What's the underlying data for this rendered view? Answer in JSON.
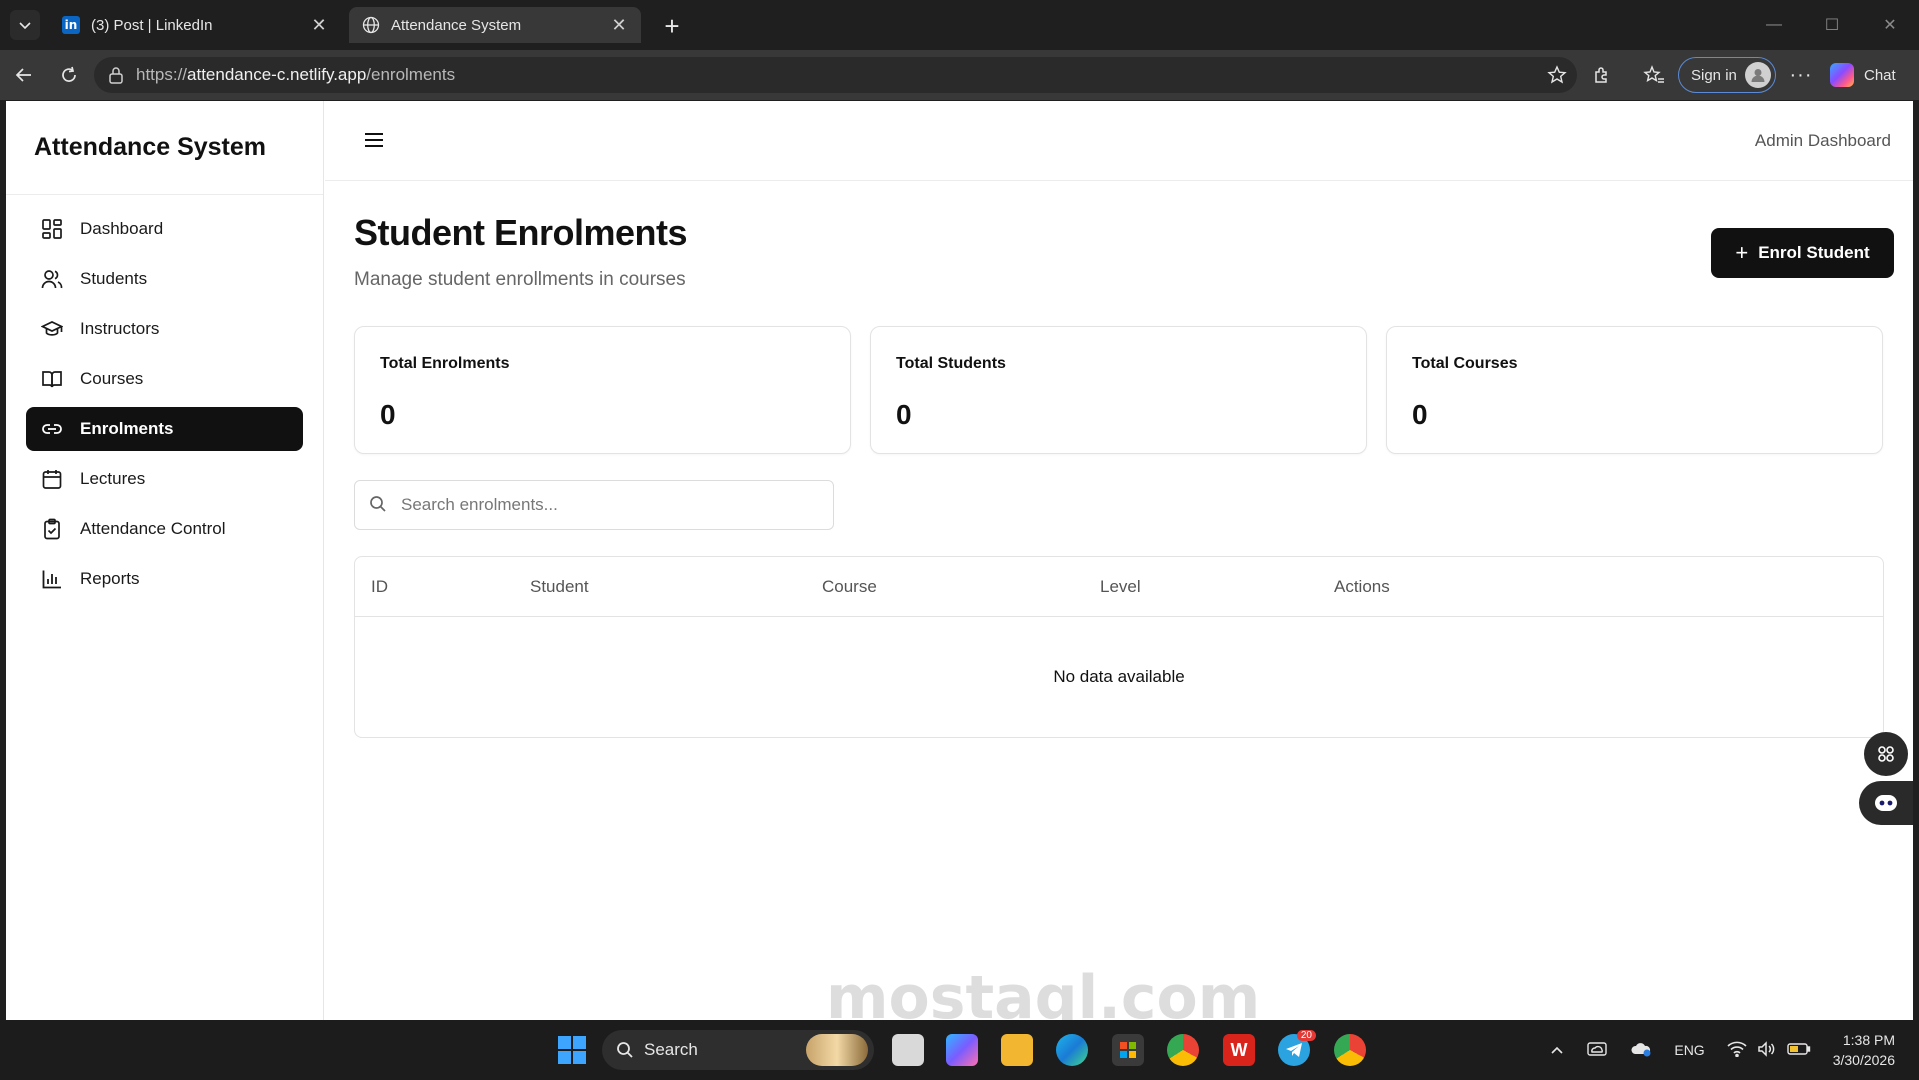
{
  "browser": {
    "tabs": [
      {
        "title": "(3) Post | LinkedIn",
        "icon": "linkedin-icon"
      },
      {
        "title": "Attendance System",
        "icon": "globe-icon"
      }
    ],
    "address": {
      "scheme": "https://",
      "host": "attendance-c.netlify.app",
      "path": "/enrolments"
    },
    "signin_label": "Sign in",
    "chat_label": "Chat"
  },
  "app": {
    "brand": "Attendance System",
    "header_right": "Admin Dashboard",
    "nav": [
      {
        "label": "Dashboard",
        "icon": "dashboard-icon",
        "active": false
      },
      {
        "label": "Students",
        "icon": "users-icon",
        "active": false
      },
      {
        "label": "Instructors",
        "icon": "graduation-cap-icon",
        "active": false
      },
      {
        "label": "Courses",
        "icon": "book-icon",
        "active": false
      },
      {
        "label": "Enrolments",
        "icon": "link-icon",
        "active": true
      },
      {
        "label": "Lectures",
        "icon": "calendar-icon",
        "active": false
      },
      {
        "label": "Attendance Control",
        "icon": "clipboard-check-icon",
        "active": false
      },
      {
        "label": "Reports",
        "icon": "bar-chart-icon",
        "active": false
      }
    ]
  },
  "page": {
    "title": "Student Enrolments",
    "subtitle": "Manage student enrollments in courses",
    "enrol_button": "Enrol Student",
    "stats": [
      {
        "label": "Total Enrolments",
        "value": "0"
      },
      {
        "label": "Total Students",
        "value": "0"
      },
      {
        "label": "Total Courses",
        "value": "0"
      }
    ],
    "search_placeholder": "Search enrolments...",
    "table": {
      "columns": [
        "ID",
        "Student",
        "Course",
        "Level",
        "Actions"
      ],
      "rows": [],
      "empty_text": "No data available"
    }
  },
  "taskbar": {
    "search_label": "Search",
    "language": "ENG",
    "time": "1:38 PM",
    "date": "3/30/2026",
    "telegram_badge": "20"
  },
  "watermark": "mostaql.com",
  "colors": {
    "primary": "#111111",
    "accent_border": "#5b8ad6",
    "windows_blue": "#3ea5ff"
  }
}
